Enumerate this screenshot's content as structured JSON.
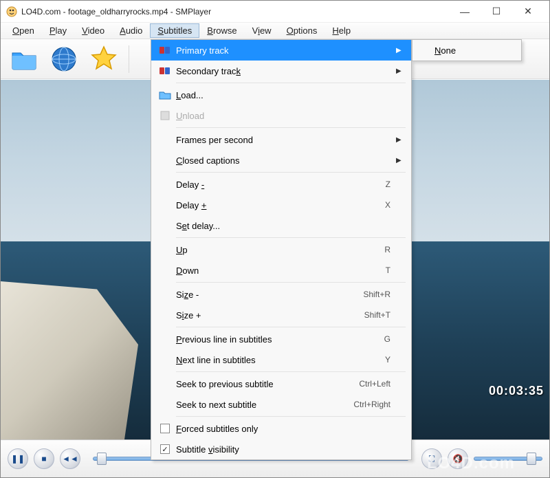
{
  "titlebar": {
    "title": "LO4D.com - footage_oldharryrocks.mp4 - SMPlayer"
  },
  "menubar": {
    "items": [
      {
        "label": "Open",
        "u": "O"
      },
      {
        "label": "Play",
        "u": "P"
      },
      {
        "label": "Video",
        "u": "V"
      },
      {
        "label": "Audio",
        "u": "A"
      },
      {
        "label": "Subtitles",
        "u": "S",
        "active": true
      },
      {
        "label": "Browse",
        "u": "B"
      },
      {
        "label": "View",
        "u": "V"
      },
      {
        "label": "Options",
        "u": "O"
      },
      {
        "label": "Help",
        "u": "H"
      }
    ]
  },
  "toolbar_icons": [
    "folder-icon",
    "globe-icon",
    "favorite-icon"
  ],
  "subtitles_menu": {
    "groups": [
      [
        {
          "label": "Primary track",
          "icon": "track-icon",
          "submenu": true,
          "highlight": true
        },
        {
          "label": "Secondary track",
          "u": "k",
          "icon": "track2-icon",
          "submenu": true
        }
      ],
      [
        {
          "label": "Load...",
          "u": "L",
          "icon": "folder-icon"
        },
        {
          "label": "Unload",
          "u": "U",
          "icon": "doc-icon",
          "disabled": true
        }
      ],
      [
        {
          "label": "Frames per second",
          "submenu": true
        },
        {
          "label": "Closed captions",
          "u": "C",
          "submenu": true
        }
      ],
      [
        {
          "label": "Delay -",
          "u": "-",
          "shortcut": "Z"
        },
        {
          "label": "Delay +",
          "u": "+",
          "shortcut": "X"
        },
        {
          "label": "Set delay...",
          "u": "e"
        }
      ],
      [
        {
          "label": "Up",
          "u": "U",
          "shortcut": "R"
        },
        {
          "label": "Down",
          "u": "D",
          "shortcut": "T"
        }
      ],
      [
        {
          "label": "Size -",
          "u": "z",
          "shortcut": "Shift+R"
        },
        {
          "label": "Size +",
          "u": "i",
          "shortcut": "Shift+T"
        }
      ],
      [
        {
          "label": "Previous line in subtitles",
          "u": "P",
          "shortcut": "G"
        },
        {
          "label": "Next line in subtitles",
          "u": "N",
          "shortcut": "Y"
        }
      ],
      [
        {
          "label": "Seek to previous subtitle",
          "shortcut": "Ctrl+Left"
        },
        {
          "label": "Seek to next subtitle",
          "shortcut": "Ctrl+Right"
        }
      ],
      [
        {
          "label": "Forced subtitles only",
          "u": "F",
          "checkbox": true,
          "checked": false
        },
        {
          "label": "Subtitle visibility",
          "u": "v",
          "checkbox": true,
          "checked": true
        }
      ]
    ]
  },
  "submenu_primary": {
    "item0": "None",
    "u": "N"
  },
  "playback": {
    "timestamp": "00:03:35",
    "volume_position_pct": 78,
    "seek_position_pct": 1
  },
  "watermark": "LO4D.com"
}
